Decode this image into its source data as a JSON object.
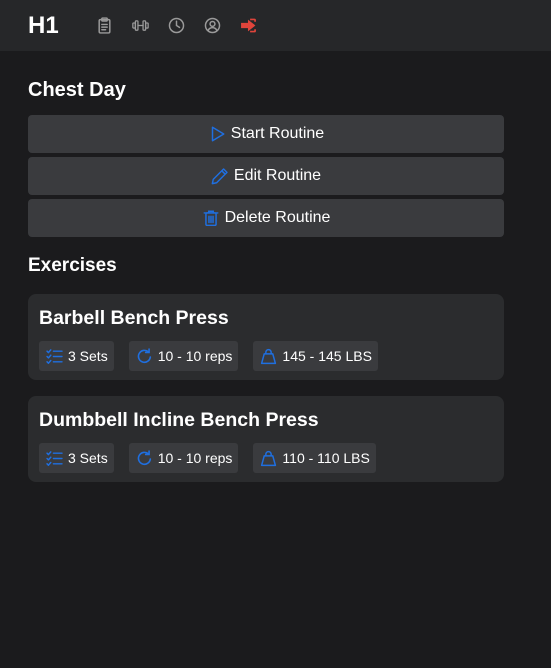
{
  "header": {
    "brand": "H1",
    "nav": [
      {
        "icon": "clipboard-icon",
        "color": "#9a9a9a"
      },
      {
        "icon": "dumbbell-icon",
        "color": "#9a9a9a"
      },
      {
        "icon": "clock-icon",
        "color": "#9a9a9a"
      },
      {
        "icon": "user-circle-icon",
        "color": "#9a9a9a"
      },
      {
        "icon": "logout-icon",
        "color": "#e0443b"
      }
    ]
  },
  "routine": {
    "title": "Chest Day",
    "actions": {
      "start": "Start Routine",
      "edit": "Edit Routine",
      "delete": "Delete Routine"
    }
  },
  "exercises": {
    "heading": "Exercises",
    "items": [
      {
        "name": "Barbell Bench Press",
        "sets": "3 Sets",
        "reps": "10 - 10 reps",
        "weight": "145 - 145 LBS"
      },
      {
        "name": "Dumbbell Incline Bench Press",
        "sets": "3 Sets",
        "reps": "10 - 10 reps",
        "weight": "110 - 110 LBS"
      }
    ]
  },
  "colors": {
    "accent": "#1f6fe0",
    "logout": "#e0443b",
    "background": "#1b1b1d",
    "topbar": "#262729",
    "card": "#2b2c2e",
    "button": "#3a3b3e"
  }
}
